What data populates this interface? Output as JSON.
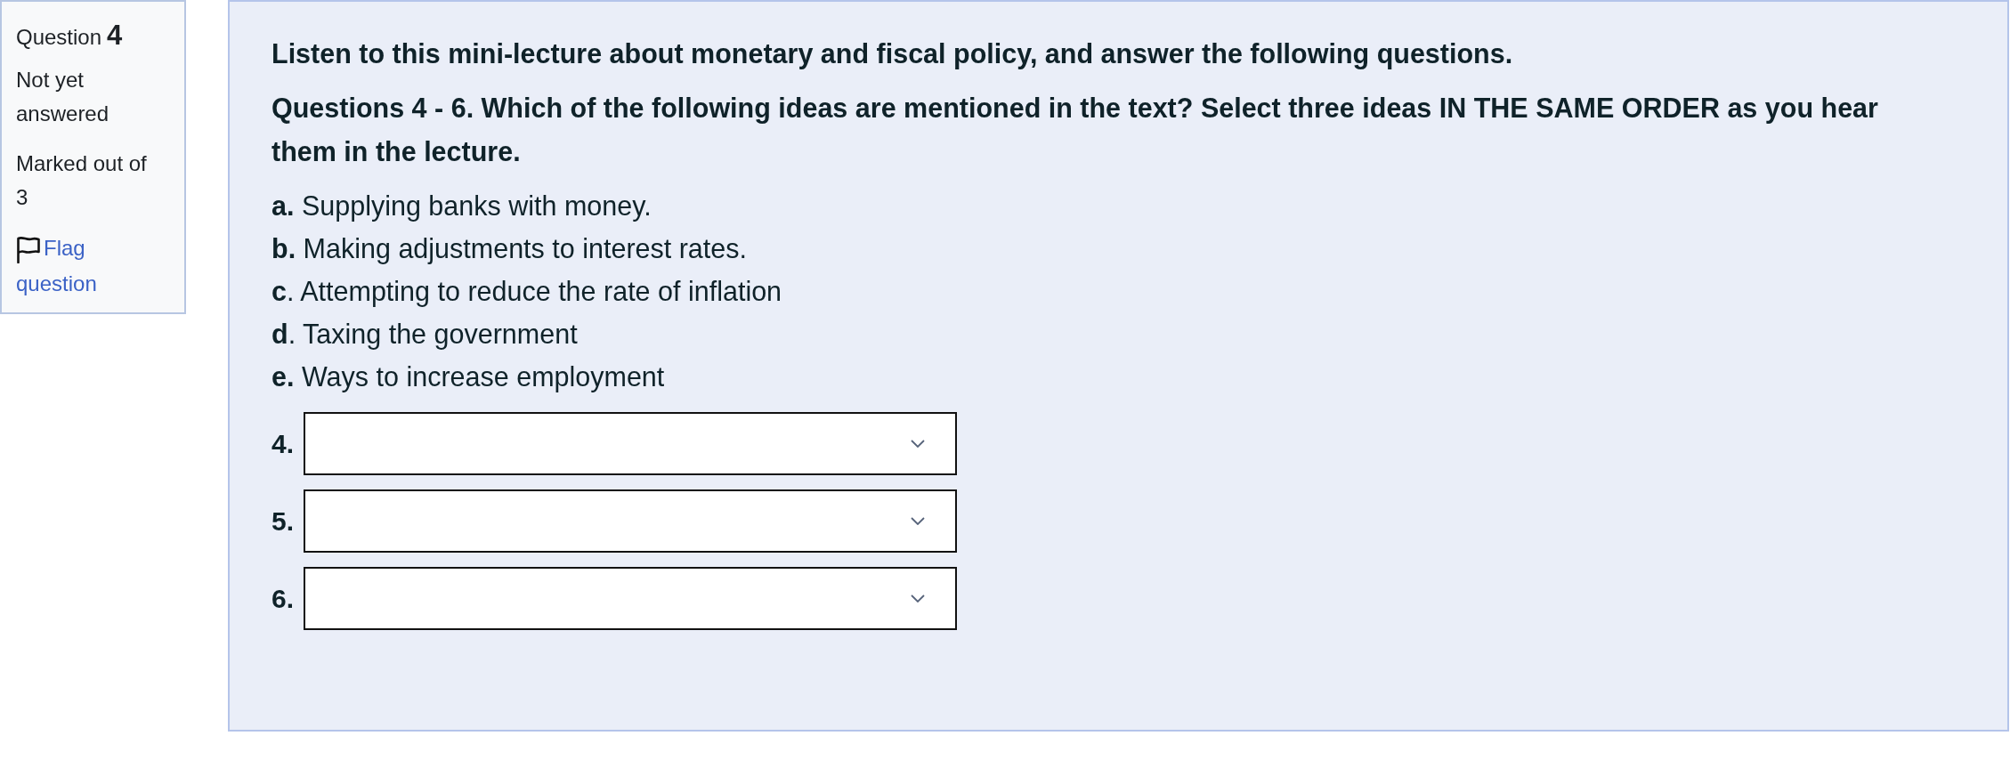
{
  "question_info": {
    "label": "Question",
    "number": "4",
    "status": "Not yet answered",
    "grade": "Marked out of 3",
    "flag": {
      "label": "Flag question",
      "flagged": false
    }
  },
  "content": {
    "intro": "Listen to this mini-lecture about monetary and fiscal policy, and answer the following questions.",
    "instruction": "Questions 4 - 6. Which of the following ideas are mentioned in the text? Select three ideas IN THE SAME ORDER as you hear them in the lecture.",
    "options": [
      "**a.** Supplying banks with money.",
      "**b.** Making adjustments to interest rates.",
      "**c**. Attempting to reduce the rate of inflation",
      "**d**. Taxing the government",
      "**e.** Ways to increase employment"
    ],
    "answers": [
      {
        "label": "4."
      },
      {
        "label": "5."
      },
      {
        "label": "6."
      }
    ]
  }
}
